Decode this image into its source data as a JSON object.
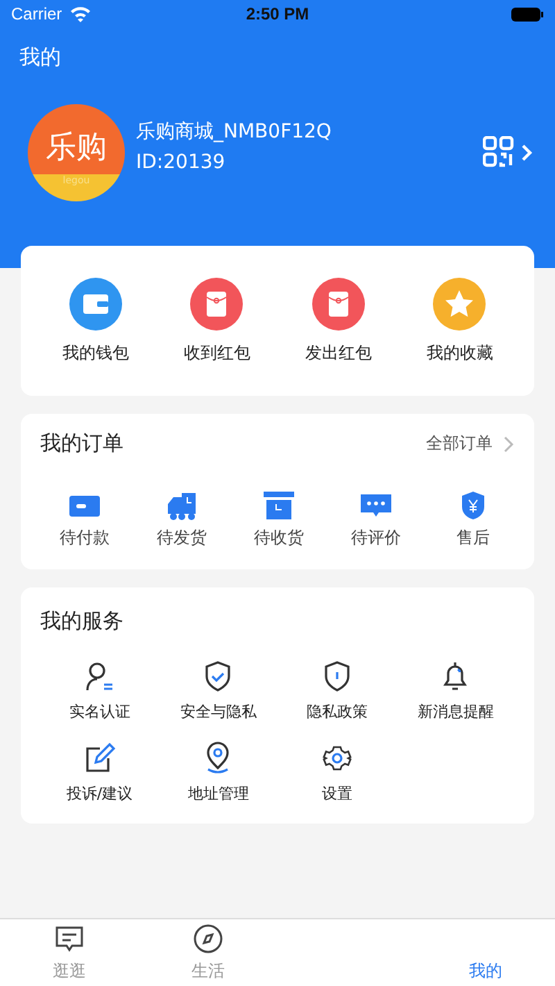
{
  "status_bar": {
    "carrier": "Carrier",
    "time": "2:50 PM"
  },
  "header": {
    "title": "我的"
  },
  "profile": {
    "avatar_text": "乐购",
    "avatar_subtext": "legou",
    "name": "乐购商城_NMB0F12Q",
    "id": "ID:20139"
  },
  "quick_actions": [
    {
      "label": "我的钱包",
      "kind": "wallet",
      "color": "#2f95f0"
    },
    {
      "label": "收到红包",
      "kind": "envelope",
      "color": "#f2555a"
    },
    {
      "label": "发出红包",
      "kind": "envelope",
      "color": "#f2555a"
    },
    {
      "label": "我的收藏",
      "kind": "star",
      "color": "#f6b02c"
    }
  ],
  "orders": {
    "title": "我的订单",
    "link": "全部订单",
    "items": [
      {
        "label": "待付款",
        "kind": "card"
      },
      {
        "label": "待发货",
        "kind": "truck"
      },
      {
        "label": "待收货",
        "kind": "box"
      },
      {
        "label": "待评价",
        "kind": "chat"
      },
      {
        "label": "售后",
        "kind": "shield"
      }
    ]
  },
  "services": {
    "title": "我的服务",
    "items": [
      {
        "label": "实名认证",
        "kind": "person"
      },
      {
        "label": "安全与隐私",
        "kind": "shield-check"
      },
      {
        "label": "隐私政策",
        "kind": "shield-info"
      },
      {
        "label": "新消息提醒",
        "kind": "bell"
      },
      {
        "label": "投诉/建议",
        "kind": "edit"
      },
      {
        "label": "地址管理",
        "kind": "pin"
      },
      {
        "label": "设置",
        "kind": "gear"
      }
    ]
  },
  "tab_bar": [
    {
      "label": "逛逛",
      "kind": "message",
      "selected": false
    },
    {
      "label": "生活",
      "kind": "compass",
      "selected": false
    },
    {
      "label": "我的",
      "kind": "none",
      "selected": true
    }
  ]
}
